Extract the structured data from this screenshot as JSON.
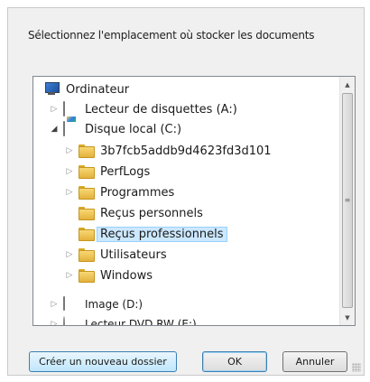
{
  "dialog": {
    "prompt": "Sélectionnez l'emplacement où stocker les documents"
  },
  "tree": {
    "items": [
      {
        "label": "Ordinateur",
        "icon": "computer-icon",
        "expander": "",
        "level": 0
      },
      {
        "label": "Lecteur de disquettes (A:)",
        "icon": "floppy-drive-icon",
        "expander": "▷",
        "level": 1
      },
      {
        "label": "Disque local (C:)",
        "icon": "local-disk-icon",
        "expander": "◢",
        "level": 1
      },
      {
        "label": "3b7fcb5addb9d4623fd3d101",
        "icon": "folder-icon",
        "expander": "▷",
        "level": 2
      },
      {
        "label": "PerfLogs",
        "icon": "folder-icon",
        "expander": "▷",
        "level": 2
      },
      {
        "label": "Programmes",
        "icon": "folder-icon",
        "expander": "▷",
        "level": 2
      },
      {
        "label": "Reçus personnels",
        "icon": "folder-icon",
        "expander": "",
        "level": 2
      },
      {
        "label": "Reçus professionnels",
        "icon": "folder-icon",
        "expander": "",
        "level": 2,
        "selected": true
      },
      {
        "label": "Utilisateurs",
        "icon": "folder-icon",
        "expander": "▷",
        "level": 2
      },
      {
        "label": "Windows",
        "icon": "folder-icon",
        "expander": "▷",
        "level": 2
      },
      {
        "label": "Image (D:)",
        "icon": "disk-drive-icon",
        "expander": "▷",
        "level": 1
      },
      {
        "label": "Lecteur DVD RW (E:)",
        "icon": "dvd-drive-icon",
        "expander": "▷",
        "level": 1
      }
    ]
  },
  "buttons": {
    "new_folder": "Créer un nouveau dossier",
    "ok": "OK",
    "cancel": "Annuler"
  },
  "scrollbar": {
    "up_glyph": "▲",
    "down_glyph": "▼",
    "grip_glyph": "≡"
  },
  "colors": {
    "selection_bg": "#cce8ff",
    "selection_border": "#99d1ff",
    "folder": "#f8d775"
  }
}
